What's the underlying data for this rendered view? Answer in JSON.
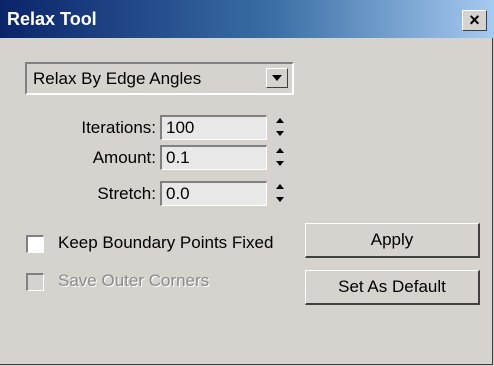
{
  "window": {
    "title": "Relax Tool",
    "close_label": "×"
  },
  "dropdown": {
    "selected": "Relax By Edge Angles"
  },
  "fields": [
    {
      "label": "Iterations:",
      "value": "100"
    },
    {
      "label": "Amount:",
      "value": "0.1"
    },
    {
      "label": "Stretch:",
      "value": "0.0"
    }
  ],
  "checkboxes": [
    {
      "label": "Keep Boundary Points Fixed",
      "checked": false,
      "enabled": true
    },
    {
      "label": "Save Outer Corners",
      "checked": false,
      "enabled": false
    }
  ],
  "buttons": {
    "apply": "Apply",
    "set_default": "Set As Default"
  },
  "icons": {
    "close": "close-icon",
    "dropdown": "chevron-down-icon",
    "spinner_up": "arrow-up-icon",
    "spinner_down": "arrow-down-icon"
  }
}
